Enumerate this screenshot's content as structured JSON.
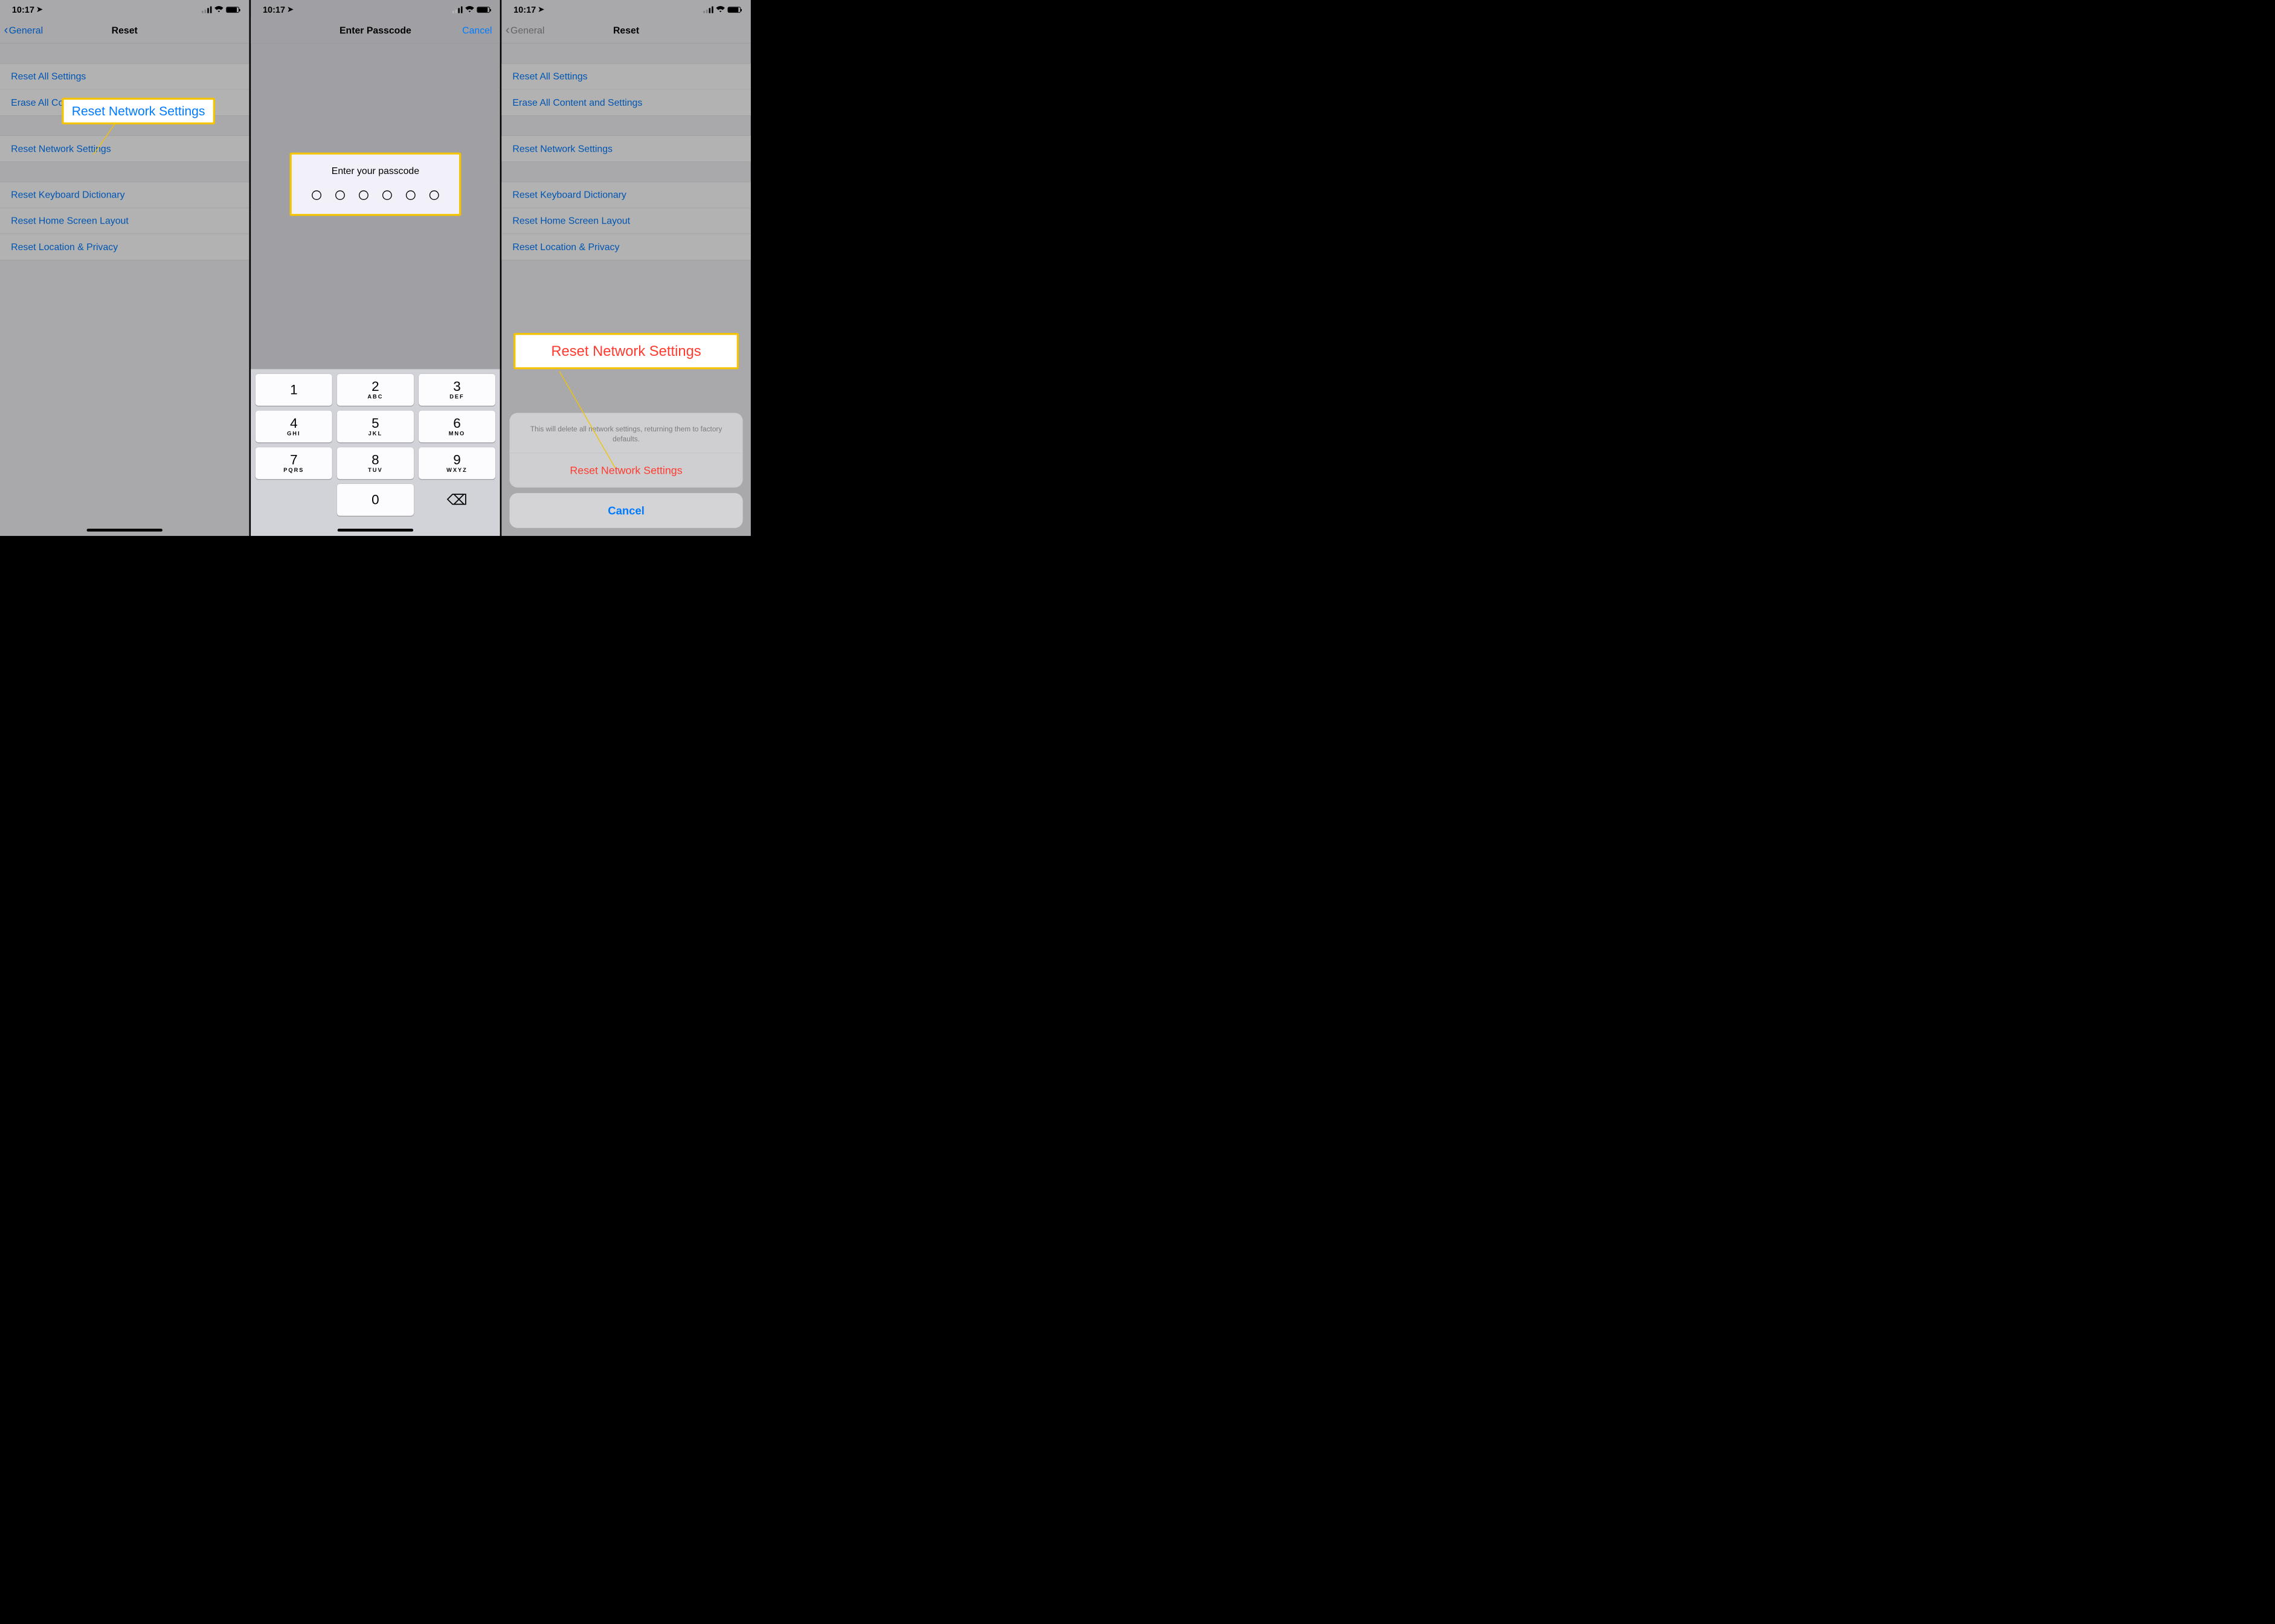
{
  "status": {
    "time": "10:17",
    "location_arrow": "➤"
  },
  "phone1": {
    "back_label": "General",
    "title": "Reset",
    "groups": [
      [
        "Reset All Settings",
        "Erase All Content and Settings"
      ],
      [
        "Reset Network Settings"
      ],
      [
        "Reset Keyboard Dictionary",
        "Reset Home Screen Layout",
        "Reset Location & Privacy"
      ]
    ],
    "callout_label": "Reset Network Settings"
  },
  "phone2": {
    "title": "Enter Passcode",
    "cancel": "Cancel",
    "prompt": "Enter your passcode",
    "keypad": [
      {
        "d": "1",
        "l": ""
      },
      {
        "d": "2",
        "l": "ABC"
      },
      {
        "d": "3",
        "l": "DEF"
      },
      {
        "d": "4",
        "l": "GHI"
      },
      {
        "d": "5",
        "l": "JKL"
      },
      {
        "d": "6",
        "l": "MNO"
      },
      {
        "d": "7",
        "l": "PQRS"
      },
      {
        "d": "8",
        "l": "TUV"
      },
      {
        "d": "9",
        "l": "WXYZ"
      },
      {
        "d": "",
        "l": ""
      },
      {
        "d": "0",
        "l": ""
      },
      {
        "d": "⌫",
        "l": ""
      }
    ]
  },
  "phone3": {
    "back_label": "General",
    "title": "Reset",
    "groups": [
      [
        "Reset All Settings",
        "Erase All Content and Settings"
      ],
      [
        "Reset Network Settings"
      ],
      [
        "Reset Keyboard Dictionary",
        "Reset Home Screen Layout",
        "Reset Location & Privacy"
      ]
    ],
    "callout_label": "Reset Network Settings",
    "sheet_msg": "This will delete all network settings, returning them to factory defaults.",
    "sheet_action": "Reset Network Settings",
    "sheet_cancel": "Cancel"
  }
}
